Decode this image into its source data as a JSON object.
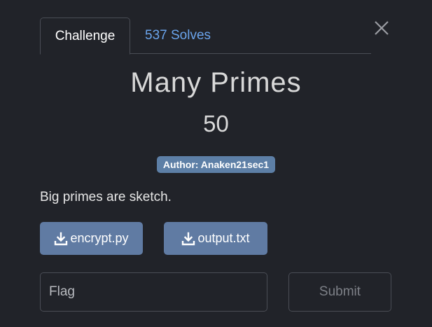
{
  "tabs": {
    "challenge": "Challenge",
    "solves": "537 Solves"
  },
  "challenge": {
    "name": "Many Primes",
    "value": "50",
    "author": "Author: Anaken21sec1",
    "description": "Big primes are sketch."
  },
  "files": [
    {
      "label": "encrypt.py",
      "icon": "download-icon"
    },
    {
      "label": "output.txt",
      "icon": "download-icon"
    }
  ],
  "flag": {
    "placeholder": "Flag",
    "submit_label": "Submit"
  },
  "colors": {
    "background": "#212329",
    "accent_link": "#6aa4ec",
    "button": "#607ba3",
    "badge": "#5d7fa6"
  }
}
